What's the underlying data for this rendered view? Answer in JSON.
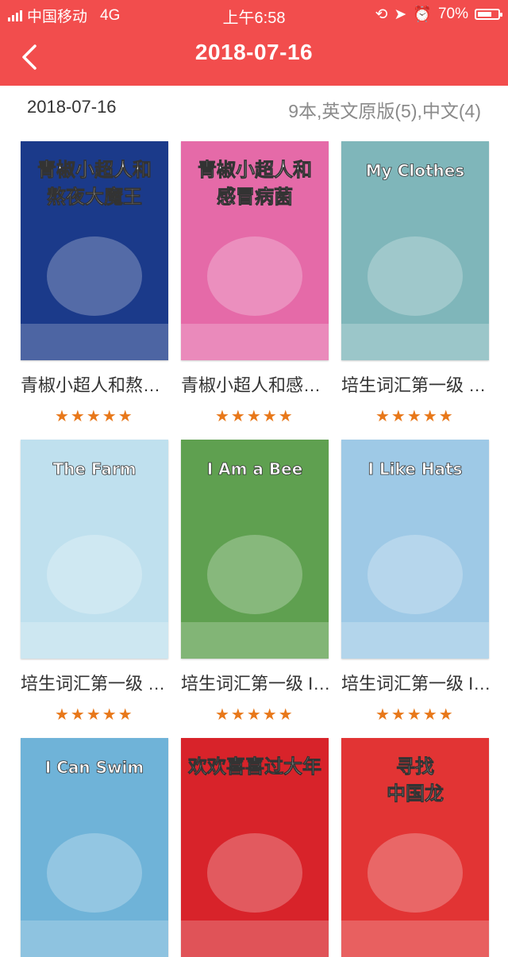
{
  "status_bar": {
    "carrier": "中国移动",
    "network": "4G",
    "time": "上午6:58",
    "battery": "70%",
    "battery_level": 0.7
  },
  "nav": {
    "title": "2018-07-16",
    "back_icon": "chevron-left-icon"
  },
  "info": {
    "date": "2018-07-16",
    "summary": "9本,英文原版(5),中文(4)"
  },
  "books": [
    {
      "title": "青椒小超人和熬夜大魔王",
      "rating": 5,
      "cover_text": [
        "青椒小超人和",
        "熬夜大魔王"
      ],
      "color": "#1b3a8a"
    },
    {
      "title": "青椒小超人和感冒病菌",
      "rating": 5,
      "cover_text": [
        "青椒小超人和",
        "感冒病菌"
      ],
      "color": "#e56aa8"
    },
    {
      "title": "培生词汇第一级 My Clothes",
      "rating": 5,
      "cover_text": [
        "My Clothes"
      ],
      "color": "#7fb6ba"
    },
    {
      "title": "培生词汇第一级 The Farm",
      "rating": 5,
      "cover_text": [
        "The Farm"
      ],
      "color": "#bfe0ee"
    },
    {
      "title": "培生词汇第一级 I Am a Bee",
      "rating": 5,
      "cover_text": [
        "I Am a Bee"
      ],
      "color": "#5fa050"
    },
    {
      "title": "培生词汇第一级 I Like Hats",
      "rating": 5,
      "cover_text": [
        "I Like Hats"
      ],
      "color": "#9ec9e6"
    },
    {
      "title": "",
      "rating": 0,
      "cover_text": [
        "I Can Swim"
      ],
      "color": "#6fb3d8"
    },
    {
      "title": "",
      "rating": 0,
      "cover_text": [
        "欢欢喜喜过大年"
      ],
      "color": "#d8232a"
    },
    {
      "title": "",
      "rating": 0,
      "cover_text": [
        "寻找",
        "中国龙"
      ],
      "color": "#e23434"
    }
  ],
  "star_glyph": "★"
}
